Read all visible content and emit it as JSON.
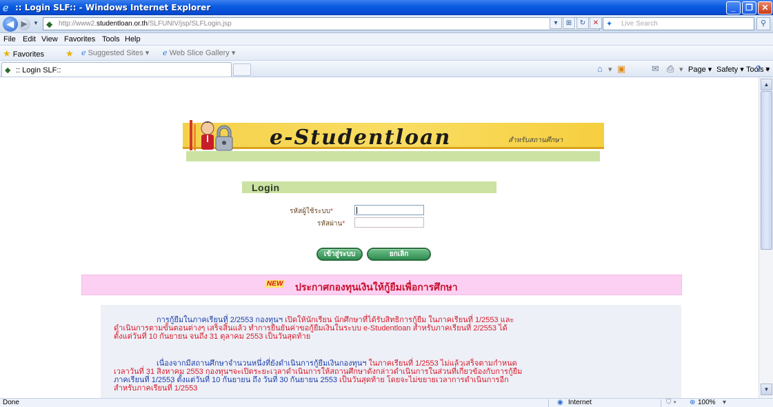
{
  "window": {
    "title": ":: Login SLF:: - Windows Internet Explorer",
    "minimize": "_",
    "maximize": "❐",
    "close": "✕"
  },
  "address": {
    "url_prefix": "http://www2.",
    "url_domain": "studentloan.or.th",
    "url_path": "/SLFUNIV/jsp/SLFLogin.jsp",
    "search_placeholder": "Live Search"
  },
  "menu": [
    "File",
    "Edit",
    "View",
    "Favorites",
    "Tools",
    "Help"
  ],
  "favorites_bar": {
    "favorites": "Favorites",
    "suggested": "Suggested Sites ▾",
    "web_slice": "Web Slice Gallery ▾"
  },
  "tab": {
    "label": ":: Login SLF::"
  },
  "commands": {
    "page": "Page ▾",
    "safety": "Safety ▾",
    "tools": "Tools ▾",
    "more": "»"
  },
  "banner": {
    "brand": "e-Studentloan",
    "subtitle": "สำหรับสถานศึกษา"
  },
  "login": {
    "heading": "Login",
    "username_label": "รหัสผู้ใช้ระบบ",
    "password_label": "รหัสผ่าน",
    "required_mark": "*",
    "username_value": "",
    "password_value": "",
    "submit_label": "เข้าสู่ระบบ",
    "cancel_label": "ยกเลิก"
  },
  "announcement": {
    "badge": "NEW",
    "title": "ประกาศกองทุนเงินให้กู้ยืมเพื่อการศึกษา",
    "p1_blue": "การกู้ยืมในภาคเรียนที่ 2/2553 กองทุนฯ",
    "p1_line1_red": " เปิดให้นักเรียน นักศึกษาที่ได้รับสิทธิการกู้ยืม ในภาคเรียนที่ 1/2553 และ",
    "p1_line2": "ดำเนินการตามขั้นตอนต่างๆ เสร็จสิ้นแล้ว ทำการยืนยันค่าขอกู้ยืมเงินในระบบ e-Studentloan สำหรับภาคเรียนที่ 2/2553 ได้",
    "p1_line3": "ตั้งแต่วันที่ 10 กันยายน จนถึง 31 ตุลาคม 2553 เป็นวันสุดท้าย",
    "p2_line1_blue": "เนื่องจากมีสถานศึกษาจำนวนหนึ่งที่ยังดำเนินการกู้ยืมเงินกองทุนฯ",
    "p2_line1_red": " ในภาคเรียนที่ 1/2553 ไม่แล้วเสร็จตามกำหนด",
    "p2_line2_blue": "เวลาวันที่ 31 สิงหาคม 2553 กองทุนฯจะเปิดระยะเวลาดำเนินการให้สถานศึกษาดังกล่าวดำเนินการในส่วนที่เกี่ยวข้องกับการกู้ยืม",
    "p2_line3_blue": "ภาคเรียนที่ 1/2553 ตั้งแต่วันที่ 10 กันยายน ถึง วันที่ 30 กันยายน 2553",
    "p2_line3_red": " เป็นวันสุดท้าย โดยจะไม่ขยายเวลาการดำเนินการอีก",
    "p2_line4": "สำหรับภาคเรียนที่ 1/2553"
  },
  "status": {
    "left": "Done",
    "zone": "Internet",
    "zoom": "100%"
  }
}
